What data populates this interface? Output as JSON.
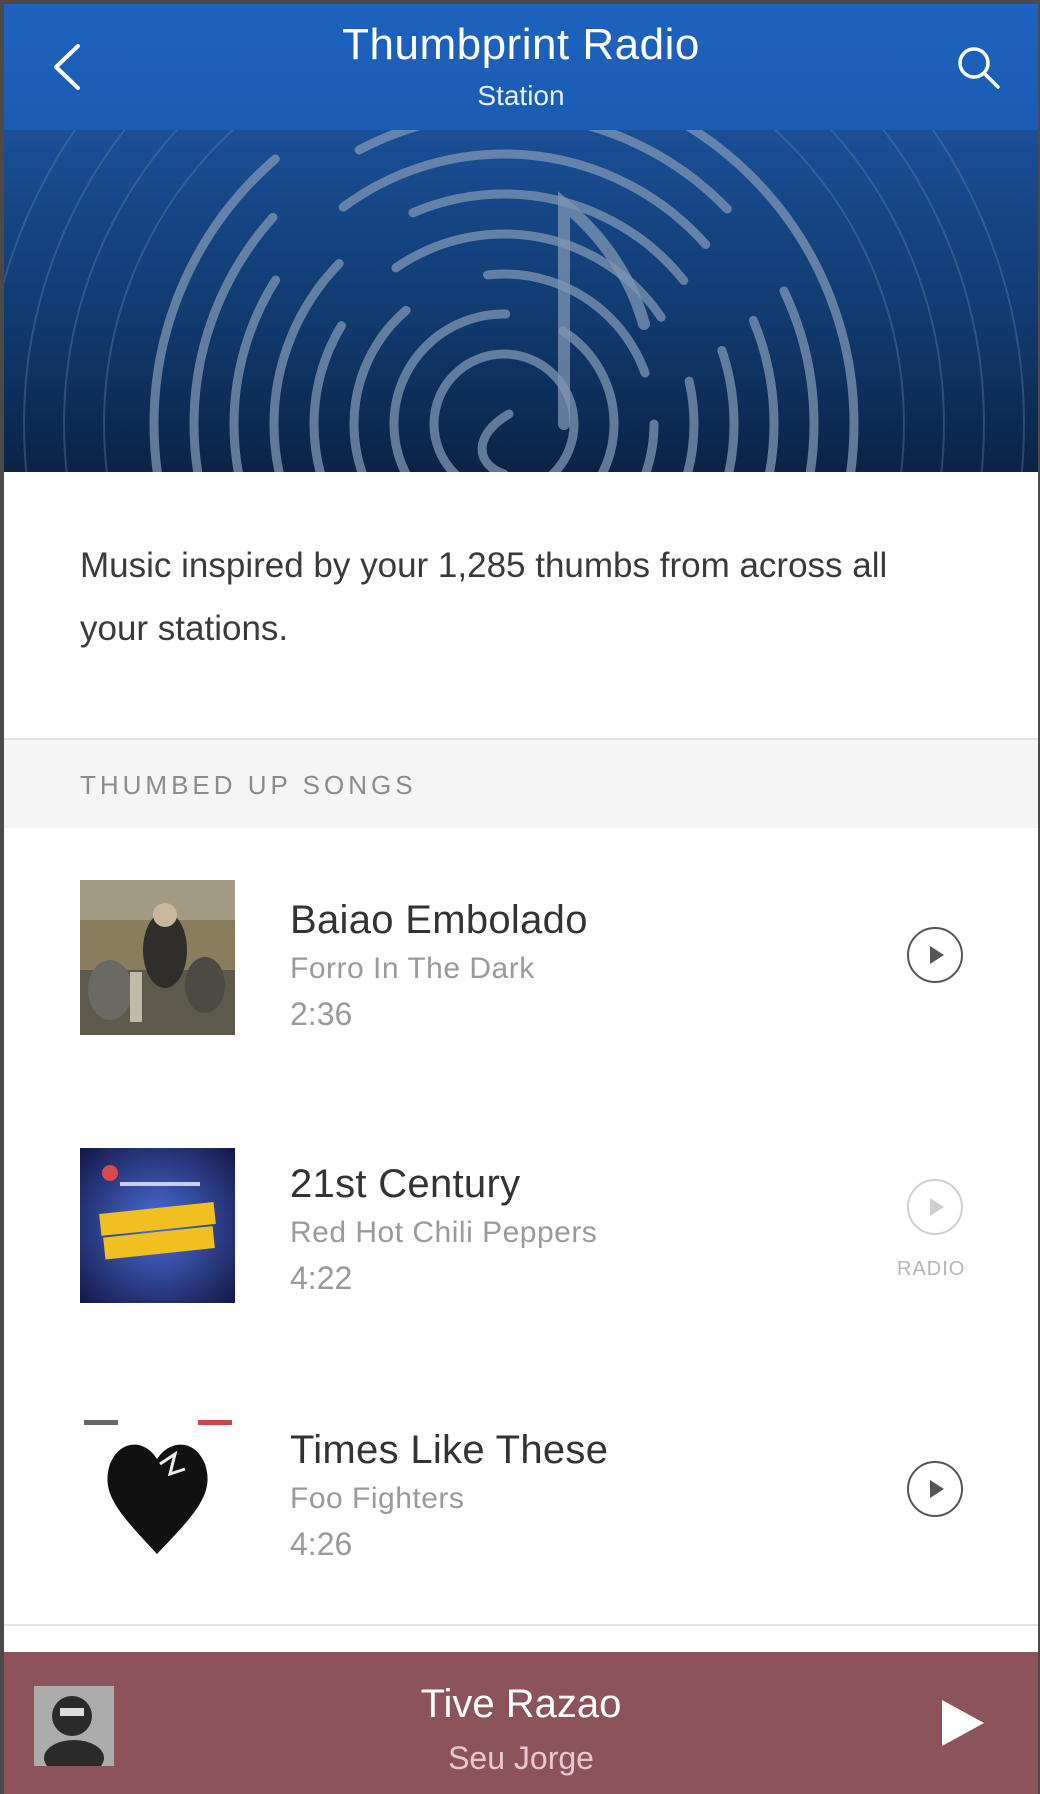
{
  "header": {
    "title": "Thumbprint Radio",
    "subtitle": "Station",
    "back_icon": "chevron-left-icon",
    "search_icon": "search-icon"
  },
  "description": "Music inspired by your 1,285 thumbs from across all your stations.",
  "section": {
    "heading": "THUMBED UP SONGS"
  },
  "songs": [
    {
      "title": "Baiao Embolado",
      "artist": "Forro In The Dark",
      "duration": "2:36",
      "action": "play"
    },
    {
      "title": "21st Century",
      "artist": "Red Hot Chili Peppers",
      "duration": "4:22",
      "action": "radio",
      "action_label": "RADIO"
    },
    {
      "title": "Times Like These",
      "artist": "Foo Fighters",
      "duration": "4:26",
      "action": "play"
    }
  ],
  "now_playing": {
    "title": "Tive Razao",
    "artist": "Seu Jorge",
    "play_icon": "play-icon"
  },
  "colors": {
    "header": "#1d63bf",
    "hero": "#113a70",
    "now_playing": "#8c535b"
  }
}
